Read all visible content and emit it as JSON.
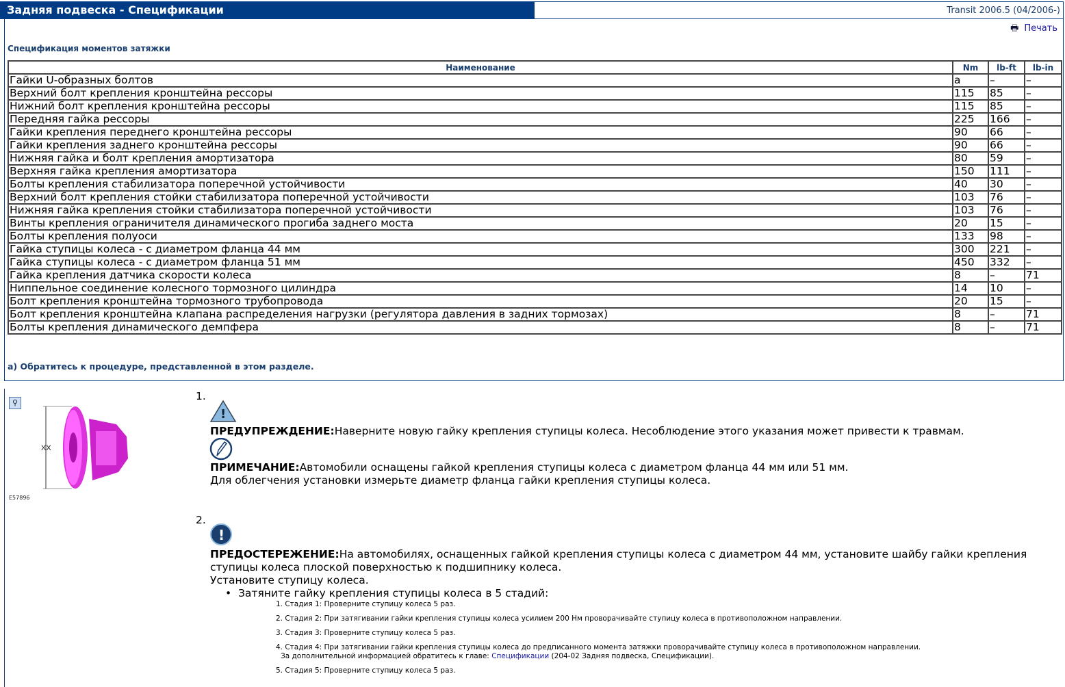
{
  "header": {
    "title": "Задняя подвеска - Спецификации",
    "model": "Transit 2006.5 (04/2006-)",
    "print_label": "Печать"
  },
  "spec": {
    "subtitle": "Спецификация моментов затяжки",
    "columns": [
      "Наименование",
      "Nm",
      "lb-ft",
      "lb-in"
    ],
    "rows": [
      [
        "Гайки U-образных болтов",
        "a",
        "–",
        "–"
      ],
      [
        "Верхний болт крепления кронштейна рессоры",
        "115",
        "85",
        "–"
      ],
      [
        "Нижний болт крепления кронштейна рессоры",
        "115",
        "85",
        "–"
      ],
      [
        "Передняя гайка рессоры",
        "225",
        "166",
        "–"
      ],
      [
        "Гайки крепления переднего кронштейна рессоры",
        "90",
        "66",
        "–"
      ],
      [
        "Гайки крепления заднего кронштейна рессоры",
        "90",
        "66",
        "–"
      ],
      [
        "Нижняя гайка и болт крепления амортизатора",
        "80",
        "59",
        "–"
      ],
      [
        "Верхняя гайка крепления амортизатора",
        "150",
        "111",
        "–"
      ],
      [
        "Болты крепления стабилизатора поперечной устойчивости",
        "40",
        "30",
        "–"
      ],
      [
        "Верхний болт крепления стойки стабилизатора поперечной устойчивости",
        "103",
        "76",
        "–"
      ],
      [
        "Нижняя гайка крепления стойки стабилизатора поперечной устойчивости",
        "103",
        "76",
        "–"
      ],
      [
        "Винты крепления ограничителя динамического прогиба заднего моста",
        "20",
        "15",
        "–"
      ],
      [
        "Болты крепления полуоси",
        "133",
        "98",
        "–"
      ],
      [
        "Гайка ступицы колеса - с диаметром фланца 44 мм",
        "300",
        "221",
        "–"
      ],
      [
        "Гайка ступицы колеса - с диаметром фланца 51 мм",
        "450",
        "332",
        "–"
      ],
      [
        "Гайка крепления датчика скорости колеса",
        "8",
        "–",
        "71"
      ],
      [
        "Ниппельное соединение колесного тормозного цилиндра",
        "14",
        "10",
        "–"
      ],
      [
        "Болт крепления кронштейна тормозного трубопровода",
        "20",
        "15",
        "–"
      ],
      [
        "Болт крепления кронштейна клапана распределения нагрузки (регулятора давления в задних тормозах)",
        "8",
        "–",
        "71"
      ],
      [
        "Болты крепления динамического демпфера",
        "8",
        "–",
        "71"
      ]
    ],
    "footnote": "a) Обратитесь к процедуре, представленной в этом разделе."
  },
  "figure": {
    "dimension_label": "XX",
    "id": "E57896"
  },
  "step1": {
    "num": "1.",
    "warning_label": "ПРЕДУПРЕЖДЕНИЕ:",
    "warning_text": "Наверните новую гайку крепления ступицы колеса. Несоблюдение этого указания может привести к травмам.",
    "note_label": "ПРИМЕЧАНИЕ:",
    "note_text": "Автомобили оснащены гайкой крепления ступицы колеса с диаметром фланца 44 мм или 51 мм.",
    "note_text2": "Для облегчения установки измерьте диаметр фланца гайки крепления ступицы колеса."
  },
  "step2": {
    "num": "2.",
    "caution_label": "ПРЕДОСТЕРЕЖЕНИЕ:",
    "caution_text": "На автомобилях, оснащенных гайкой крепления ступицы колеса с диаметром 44 мм, установите шайбу гайки крепления",
    "caution_text2": "ступицы колеса плоской поверхностью к подшипнику колеса.",
    "install": "Установите ступицу колеса.",
    "bullet": "Затяните гайку крепления ступицы колеса в 5 стадий:",
    "substeps": [
      "1. Стадия 1: Проверните ступицу колеса 5 раз.",
      "2. Стадия 2: При затягивании гайки крепления ступицы колеса усилием 200 Нм проворачивайте ступицу колеса в противоположном направлении.",
      "3. Стадия 3: Проверните ступицу колеса 5 раз.",
      "4. Стадия 4: При затягивании гайки крепления ступицы колеса до предписанного момента затяжки проворачивайте ступицу колеса в противоположном направлении.",
      "5. Стадия 5: Проверните ступицу колеса 5 раз."
    ],
    "ref_prefix": "За дополнительной информацией обратитесь к главе:",
    "ref_link": "Спецификации",
    "ref_suffix": "(204-02 Задняя подвеска, Спецификации)."
  }
}
